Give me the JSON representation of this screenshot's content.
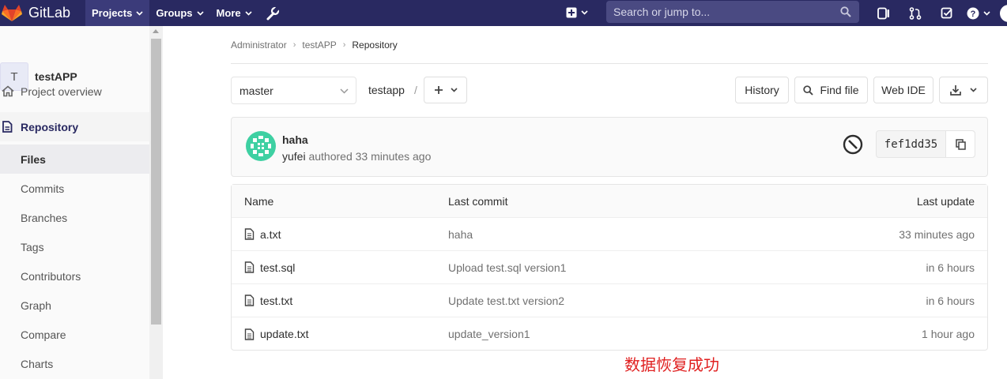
{
  "navbar": {
    "brand": "GitLab",
    "links": [
      {
        "label": "Projects",
        "active": true
      },
      {
        "label": "Groups",
        "active": false
      },
      {
        "label": "More",
        "active": false
      }
    ],
    "search_placeholder": "Search or jump to...",
    "icons": [
      "plus-icon",
      "search-icon",
      "sidebar-icon",
      "merge-request-icon",
      "todo-icon",
      "help-icon"
    ]
  },
  "sidebar": {
    "project_initial": "T",
    "project_name": "testAPP",
    "overview": "Project overview",
    "repository": "Repository",
    "repo_items": [
      "Files",
      "Commits",
      "Branches",
      "Tags",
      "Contributors",
      "Graph",
      "Compare",
      "Charts"
    ],
    "active_item": "Files"
  },
  "breadcrumb": [
    "Administrator",
    "testAPP",
    "Repository"
  ],
  "toolbar": {
    "branch": "master",
    "path": "testapp",
    "path_sep": "/",
    "history": "History",
    "find_file": "Find file",
    "web_ide": "Web IDE"
  },
  "commit": {
    "title": "haha",
    "author": "yufei",
    "meta": "authored 33 minutes ago",
    "sha": "fef1dd35"
  },
  "table": {
    "headers": {
      "name": "Name",
      "commit": "Last commit",
      "update": "Last update"
    },
    "rows": [
      {
        "name": "a.txt",
        "commit": "haha",
        "update": "33 minutes ago"
      },
      {
        "name": "test.sql",
        "commit": "Upload test.sql version1",
        "update": "in 6 hours"
      },
      {
        "name": "test.txt",
        "commit": "Update test.txt version2",
        "update": "in 6 hours"
      },
      {
        "name": "update.txt",
        "commit": "update_version1",
        "update": "1 hour ago"
      }
    ]
  },
  "note": "数据恢复成功",
  "colors": {
    "navbar": "#292961",
    "note": "#e02020",
    "avatar": "#3ed0a2"
  }
}
